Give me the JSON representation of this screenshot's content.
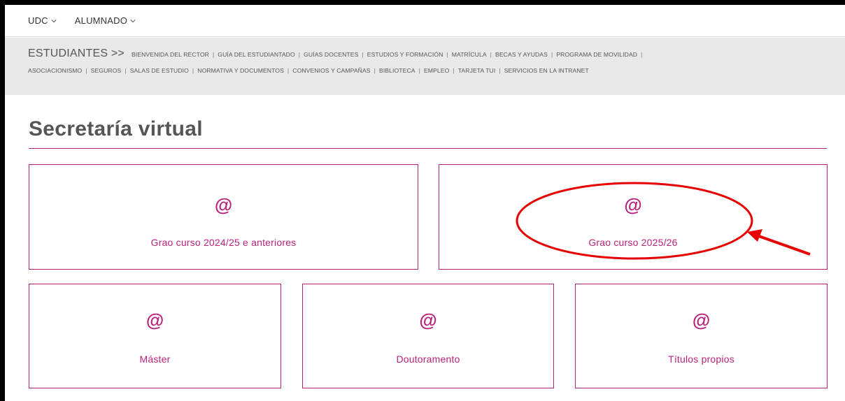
{
  "topnav": {
    "items": [
      {
        "label": "UDC"
      },
      {
        "label": "ALUMNADO"
      }
    ]
  },
  "band": {
    "section_title": "ESTUDIANTES >>",
    "links_row1": [
      "BIENVENIDA DEL RECTOR",
      "GUÍA DEL ESTUDIANTADO",
      "GUÍAS DOCENTES",
      "ESTUDIOS Y FORMACIÓN",
      "MATRÍCULA",
      "BECAS Y AYUDAS",
      "PROGRAMA DE MOVILIDAD"
    ],
    "links_row2": [
      "ASOCIACIONISMO",
      "SEGUROS",
      "SALAS DE ESTUDIO",
      "NORMATIVA Y DOCUMENTOS",
      "CONVENIOS Y CAMPAÑAS",
      "BIBLIOTECA",
      "EMPLEO",
      "TARJETA TUI",
      "SERVICIOS EN LA INTRANET"
    ]
  },
  "main": {
    "title": "Secretaría virtual",
    "cards": [
      {
        "icon_text": "@",
        "label": "Grao curso 2024/25 e anteriores"
      },
      {
        "icon_text": "@",
        "label": "Grao curso 2025/26"
      },
      {
        "icon_text": "@",
        "label": "Máster"
      },
      {
        "icon_text": "@",
        "label": "Doutoramento"
      },
      {
        "icon_text": "@",
        "label": "Títulos propios"
      }
    ]
  },
  "colors": {
    "accent": "#b8227c",
    "annotation": "#e60000",
    "band_bg": "#e9e9e9",
    "text": "#555555"
  }
}
